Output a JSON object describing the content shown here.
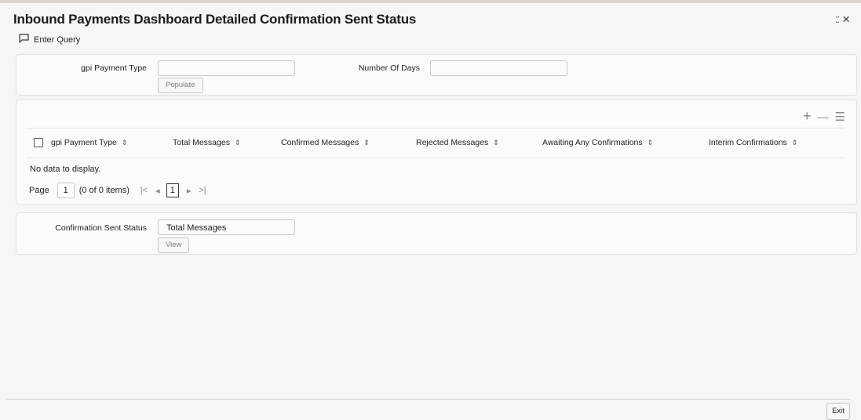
{
  "window": {
    "title": "Inbound Payments Dashboard Detailed Confirmation Sent Status",
    "collapse_icon": "⁚⁚",
    "close_icon": "×"
  },
  "toolbar": {
    "enter_query_label": "Enter Query"
  },
  "query": {
    "gpi_payment_type_label": "gpi Payment Type",
    "gpi_payment_type_value": "",
    "number_of_days_label": "Number Of Days",
    "number_of_days_value": "",
    "populate_label": "Populate"
  },
  "table": {
    "tools": {
      "add": "+",
      "remove": "—",
      "columns": "☰"
    },
    "columns": [
      "gpi Payment Type",
      "Total Messages",
      "Confirmed Messages",
      "Rejected Messages",
      "Awaiting Any Confirmations",
      "Interim Confirmations"
    ],
    "sort_glyph": "⇕",
    "empty_text": "No data to display.",
    "pager": {
      "page_label": "Page",
      "page_value": "1",
      "items_text": "(0 of 0 items)",
      "first": "|<",
      "prev": "◂",
      "current": "1",
      "next": "▸",
      "last": ">|"
    }
  },
  "status": {
    "label": "Confirmation Sent Status",
    "value": "Total Messages",
    "view_label": "View"
  },
  "footer": {
    "exit_label": "Exit"
  }
}
